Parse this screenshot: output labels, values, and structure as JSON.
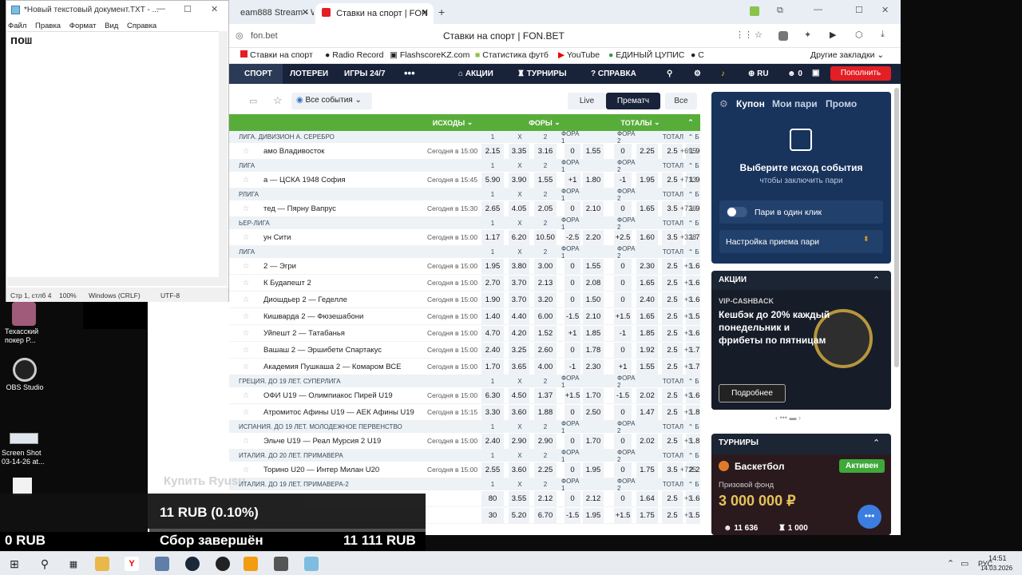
{
  "notepad": {
    "title": "*Новый текстовый документ.TXT - ...",
    "menu": [
      "Файл",
      "Правка",
      "Формат",
      "Вид",
      "Справка"
    ],
    "content": "пош",
    "status": {
      "pos": "Стр 1, стлб 4",
      "zoom": "100%",
      "eol": "Windows (CRLF)",
      "enc": "UTF-8"
    }
  },
  "desktop": {
    "icons": [
      {
        "label": "Техасский покер P..."
      },
      {
        "label": "OBS Studio"
      },
      {
        "label": "Screen Shot 03-14-26 at..."
      }
    ]
  },
  "overlay": {
    "line1": "11 RUB (0.10%)",
    "line2_left": "0 RUB",
    "line2_mid": "Сбор завершён",
    "line2_right": "11 111 RUB",
    "watermark": "Купить Ryusu"
  },
  "browser": {
    "tabs": [
      {
        "label": "eam888 Stream - Wa"
      },
      {
        "label": "Ставки на спорт | FON"
      }
    ],
    "url": "fon.bet",
    "page_title": "Ставки на спорт | FON.BET",
    "bookmarks": [
      "Ставки на спорт",
      "Radio Record",
      "FlashscoreKZ.com",
      "Статистика футб",
      "YouTube",
      "ЕДИНЫЙ ЦУПИС",
      "С",
      "Другие закладки"
    ],
    "nav": [
      "СПОРТ",
      "ЛОТЕРЕИ",
      "ИГРЫ 24/7",
      "•••",
      "АКЦИИ",
      "ТУРНИРЫ",
      "СПРАВКА",
      "RU",
      "0",
      "Пополнить"
    ],
    "filters": {
      "events": "Все события",
      "live": "Live",
      "prematch": "Прематч",
      "all": "Все"
    },
    "columns": {
      "outcomes": "ИСХОДЫ",
      "fora": "ФОРЫ",
      "totals": "ТОТАЛЫ"
    },
    "line_labels": [
      "1",
      "X",
      "2",
      "ФОРА 1",
      "ФОРА 2",
      "ТОТАЛ",
      "Б",
      "М"
    ]
  },
  "events": [
    {
      "kind": "league",
      "name": "ЛИГА. ДИВИЗИОН А. СЕРЕБРО"
    },
    {
      "kind": "event",
      "name": "амо Владивосток",
      "time": "Сегодня в 15:00",
      "o": [
        "2.15",
        "3.35",
        "3.16",
        "0",
        "1.55",
        "0",
        "2.25",
        "2.5",
        "1.95",
        "1.75"
      ],
      "more": "+695"
    },
    {
      "kind": "league",
      "name": "ЛИГА"
    },
    {
      "kind": "event",
      "name": "а — ЦСКА 1948 София",
      "time": "Сегодня в 15:45",
      "o": [
        "5.90",
        "3.90",
        "1.55",
        "+1",
        "1.80",
        "-1",
        "1.95",
        "2.5",
        "1.90",
        "1.85"
      ],
      "more": "+713"
    },
    {
      "kind": "league",
      "name": "РЛИГА"
    },
    {
      "kind": "event",
      "name": "тед — Пярну Вапрус",
      "time": "Сегодня в 15:30",
      "o": [
        "2.65",
        "4.05",
        "2.05",
        "0",
        "2.10",
        "0",
        "1.65",
        "3.5",
        "1.95",
        "1.75"
      ],
      "more": "+726"
    },
    {
      "kind": "league",
      "name": "ЬЕР-ЛИГА"
    },
    {
      "kind": "event",
      "name": "ун Сити",
      "time": "Сегодня в 15:00",
      "o": [
        "1.17",
        "6.20",
        "10.50",
        "-2.5",
        "2.20",
        "+2.5",
        "1.60",
        "3.5",
        "1.70",
        "2.02"
      ],
      "more": "+328"
    },
    {
      "kind": "league",
      "name": "ЛИГА"
    },
    {
      "kind": "event",
      "name": "2 — Эгри",
      "time": "Сегодня в 15:00",
      "o": [
        "1.95",
        "3.80",
        "3.00",
        "0",
        "1.55",
        "0",
        "2.30",
        "2.5",
        "1.60",
        "2.20"
      ],
      "more": "+3"
    },
    {
      "kind": "event",
      "name": "К Будапешт 2",
      "time": "Сегодня в 15:00",
      "o": [
        "2.70",
        "3.70",
        "2.13",
        "0",
        "2.08",
        "0",
        "1.65",
        "2.5",
        "1.65",
        "2.10"
      ],
      "more": "+3"
    },
    {
      "kind": "event",
      "name": "Диошдьер 2 — Геделле",
      "time": "Сегодня в 15:00",
      "o": [
        "1.90",
        "3.70",
        "3.20",
        "0",
        "1.50",
        "0",
        "2.40",
        "2.5",
        "1.60",
        "2.20"
      ],
      "more": "+3"
    },
    {
      "kind": "event",
      "name": "Кишварда 2 — Фюзешабони",
      "time": "Сегодня в 15:00",
      "o": [
        "1.40",
        "4.40",
        "6.00",
        "-1.5",
        "2.10",
        "+1.5",
        "1.65",
        "2.5",
        "1.55",
        "2.30"
      ],
      "more": "+3"
    },
    {
      "kind": "event",
      "name": "Уйпешт 2 — Татабанья",
      "time": "Сегодня в 15:00",
      "o": [
        "4.70",
        "4.20",
        "1.52",
        "+1",
        "1.85",
        "-1",
        "1.85",
        "2.5",
        "1.67",
        "2.07"
      ],
      "more": "+3"
    },
    {
      "kind": "event",
      "name": "Вашаш 2 — Эршибети Спартакус",
      "time": "Сегодня в 15:00",
      "o": [
        "2.40",
        "3.25",
        "2.60",
        "0",
        "1.78",
        "0",
        "1.92",
        "2.5",
        "1.77",
        "1.93"
      ],
      "more": "+3"
    },
    {
      "kind": "event",
      "name": "Академия Пушкаша 2 — Комаром ВСЕ",
      "time": "Сегодня в 15:00",
      "o": [
        "1.70",
        "3.65",
        "4.00",
        "-1",
        "2.30",
        "+1",
        "1.55",
        "2.5",
        "1.70",
        "2.02"
      ],
      "more": "+3"
    },
    {
      "kind": "league",
      "name": "ГРЕЦИЯ. ДО 19 ЛЕТ. СУПЕРЛИГА"
    },
    {
      "kind": "event",
      "name": "ОФИ U19 — Олимпиакос Пирей U19",
      "time": "Сегодня в 15:00",
      "o": [
        "6.30",
        "4.50",
        "1.37",
        "+1.5",
        "1.70",
        "-1.5",
        "2.02",
        "2.5",
        "1.60",
        "2.20"
      ],
      "more": "+3"
    },
    {
      "kind": "event",
      "name": "Атромитос Афины U19 — АЕК Афины U19",
      "time": "Сегодня в 15:15",
      "o": [
        "3.30",
        "3.60",
        "1.88",
        "0",
        "2.50",
        "0",
        "1.47",
        "2.5",
        "1.80",
        "1.90"
      ],
      "more": "+3"
    },
    {
      "kind": "league",
      "name": "ИСПАНИЯ. ДО 19 ЛЕТ. МОЛОДЕЖНОЕ ПЕРВЕНСТВО"
    },
    {
      "kind": "event",
      "name": "Эльче U19 — Реал Мурсия 2 U19",
      "time": "Сегодня в 15:00",
      "o": [
        "2.40",
        "2.90",
        "2.90",
        "0",
        "1.70",
        "0",
        "2.02",
        "2.5",
        "1.85",
        "1.85"
      ],
      "more": "+3"
    },
    {
      "kind": "league",
      "name": "ИТАЛИЯ. ДО 20 ЛЕТ. ПРИМАВЕРА"
    },
    {
      "kind": "event",
      "name": "Торино U20 — Интер Милан U20",
      "time": "Сегодня в 15:00",
      "o": [
        "2.55",
        "3.60",
        "2.25",
        "0",
        "1.95",
        "0",
        "1.75",
        "3.5",
        "2.25",
        "1.58"
      ],
      "more": "+725"
    },
    {
      "kind": "league",
      "name": "ИТАЛИЯ. ДО 19 ЛЕТ. ПРИМАВЕРА-2"
    },
    {
      "kind": "event",
      "name": "",
      "time": "",
      "o": [
        "80",
        "3.55",
        "2.12",
        "0",
        "2.12",
        "0",
        "1.64",
        "2.5",
        "1.60",
        "2.20"
      ],
      "more": "+3"
    },
    {
      "kind": "event",
      "name": "",
      "time": "",
      "o": [
        "30",
        "5.20",
        "6.70",
        "-1.5",
        "1.95",
        "+1.5",
        "1.75",
        "2.5",
        "1.57",
        "2.25"
      ],
      "more": "+3"
    }
  ],
  "coupon": {
    "tabs": [
      "Купон",
      "Мои пари",
      "Промо"
    ],
    "title": "Выберите исход события",
    "subtitle": "чтобы заключить пари",
    "oneclick": "Пари в один клик",
    "settings": "Настройка приема пари"
  },
  "promo": {
    "header": "АКЦИИ",
    "tag": "VIP-CASHBACK",
    "text": "Кешбэк до 20% каждый понедельник и фрибеты по пятницам",
    "button": "Подробнее"
  },
  "tournaments": {
    "header": "ТУРНИРЫ",
    "sport": "Баскетбол",
    "status": "Активен",
    "prize_label": "Призовой фонд",
    "prize": "3 000 000 ₽",
    "players": "11 636",
    "count": "1 000"
  },
  "taskbar": {
    "lang": "РУС",
    "time": "14:51",
    "date": "14.03.2026"
  }
}
